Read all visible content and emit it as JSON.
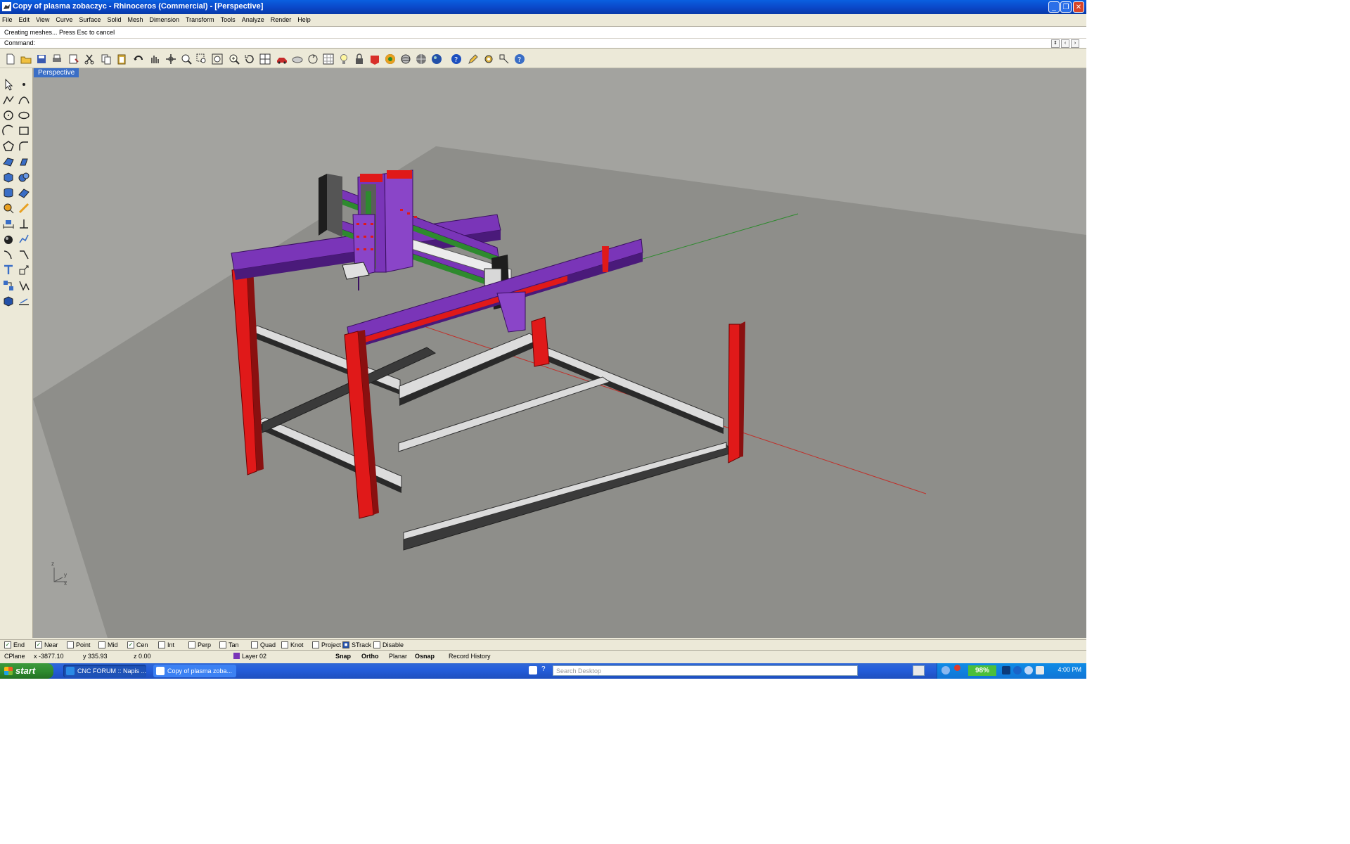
{
  "window": {
    "title": "Copy of plasma zobaczyc - Rhinoceros (Commercial) - [Perspective]",
    "controls": [
      "minimize-icon",
      "restore-icon",
      "close-icon"
    ]
  },
  "menu": [
    "File",
    "Edit",
    "View",
    "Curve",
    "Surface",
    "Solid",
    "Mesh",
    "Dimension",
    "Transform",
    "Tools",
    "Analyze",
    "Render",
    "Help"
  ],
  "command": {
    "history_line": "Creating meshes... Press Esc to cancel",
    "prompt": "Command:"
  },
  "toolbar": {
    "icons": [
      "new-icon",
      "open-icon",
      "save-icon",
      "print-icon",
      "properties-icon",
      "cut-icon",
      "copy-icon",
      "paste-icon",
      "undo-icon",
      "pan-icon",
      "rotate-view-icon",
      "zoom-dynamic-icon",
      "zoom-window-icon",
      "zoom-extents-icon",
      "zoom-selected-icon",
      "undo-view-icon",
      "four-viewports-icon",
      "car-icon",
      "shaded-icon",
      "rotate-icon",
      "grid-icon",
      "lightbulb-icon",
      "lock-icon",
      "layer-icon",
      "render-icon",
      "sphere-icon",
      "mesh-icon",
      "settings-icon",
      "help-icon"
    ]
  },
  "viewport": {
    "label": "Perspective",
    "axis_labels": {
      "z": "z",
      "y": "y",
      "x": "x"
    }
  },
  "osnaps": [
    {
      "label": "End",
      "checked": true
    },
    {
      "label": "Near",
      "checked": true
    },
    {
      "label": "Point",
      "checked": false
    },
    {
      "label": "Mid",
      "checked": false
    },
    {
      "label": "Cen",
      "checked": true
    },
    {
      "label": "Int",
      "checked": false
    },
    {
      "label": "Perp",
      "checked": false
    },
    {
      "label": "Tan",
      "checked": false
    },
    {
      "label": "Quad",
      "checked": false
    },
    {
      "label": "Knot",
      "checked": false
    },
    {
      "label": "Project",
      "checked": false
    },
    {
      "label": "STrack",
      "checked": true
    },
    {
      "label": "Disable",
      "checked": false
    }
  ],
  "status": {
    "cplane": "CPlane",
    "x": "x -3877.10",
    "y": "y 335.93",
    "z": "z 0.00",
    "layer": "Layer 02",
    "layer_color": "#7a35b8",
    "toggles": [
      "Snap",
      "Ortho",
      "Planar",
      "Osnap",
      "Record History"
    ]
  },
  "taskbar": {
    "start": "start",
    "tasks": [
      {
        "label": "CNC FORUM :: Napis ...",
        "icon": "browser-icon"
      },
      {
        "label": "Copy of plasma zoba...",
        "icon": "rhino-icon"
      }
    ],
    "search_placeholder": "Search Desktop",
    "battery": "98%",
    "clock": "4:00 PM"
  },
  "colors": {
    "frame_legs": "#e01919",
    "gantry_beams": "#7a35b8",
    "linear_rails": "#2e8a2e",
    "crossbars": "#d8d8d8",
    "viewport_bg": "#a3a39f",
    "ground_plane": "#8c8c88"
  }
}
